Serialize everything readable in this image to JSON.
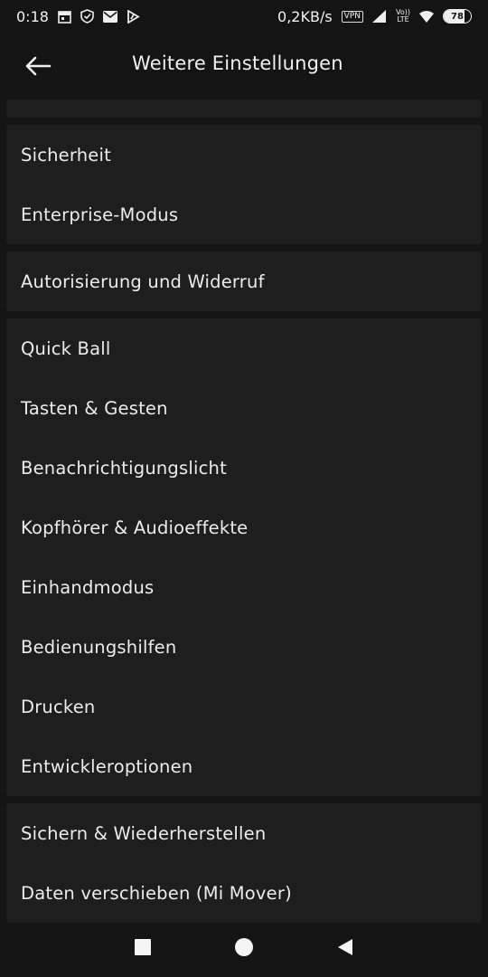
{
  "status_bar": {
    "time": "0:18",
    "speed": "0,2KB/s",
    "vpn": "VPN",
    "lte_top": "Vo))",
    "lte_bottom": "LTE",
    "battery": "78",
    "battery_level": 0.78,
    "icons": [
      "calendar-icon",
      "shield-icon",
      "mail-icon",
      "notification-icon",
      "vpn-icon",
      "signal-icon",
      "wifi-icon",
      "battery-icon"
    ]
  },
  "header": {
    "title": "Weitere Einstellungen",
    "back_icon": "arrow-left-icon"
  },
  "groups": [
    {
      "items": [
        "Sicherheit",
        "Enterprise-Modus"
      ]
    },
    {
      "items": [
        "Autorisierung und Widerruf"
      ]
    },
    {
      "items": [
        "Quick Ball",
        "Tasten & Gesten",
        "Benachrichtigungslicht",
        "Kopfhörer & Audioeffekte",
        "Einhandmodus",
        "Bedienungshilfen",
        "Drucken",
        "Entwickleroptionen"
      ]
    },
    {
      "items": [
        "Sichern & Wiederherstellen",
        "Daten verschieben (Mi Mover)"
      ]
    }
  ],
  "nav_bar": {
    "recents_icon": "square-icon",
    "home_icon": "circle-icon",
    "back_icon": "triangle-back-icon"
  },
  "colors": {
    "background": "#141414",
    "card": "#1e1e1e",
    "text": "#ececec"
  }
}
